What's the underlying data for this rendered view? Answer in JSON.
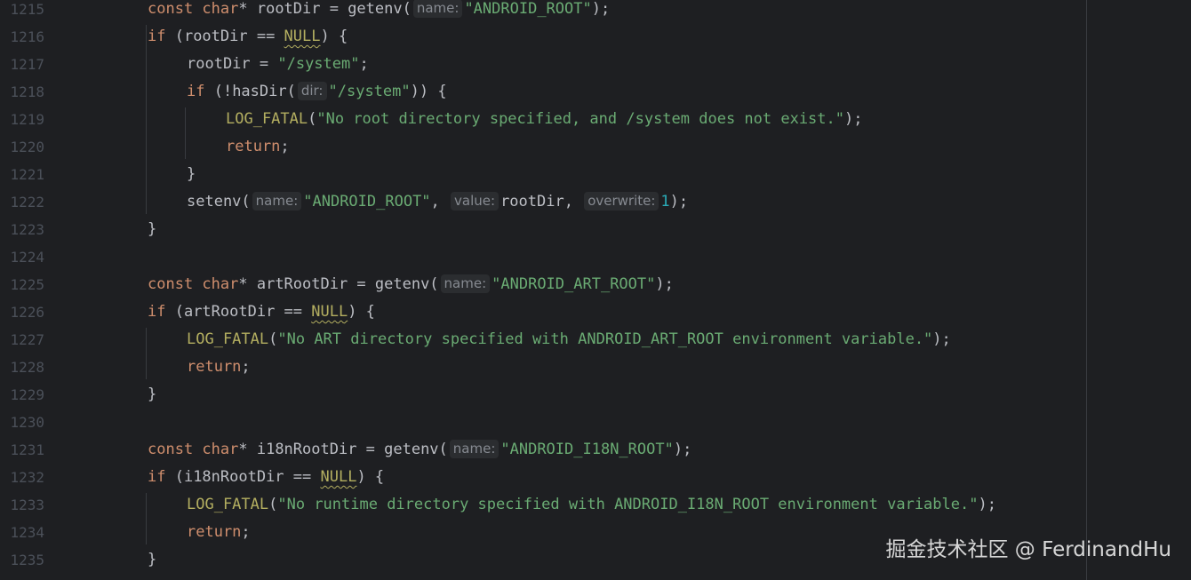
{
  "lines": [
    {
      "num": "1215",
      "indent": 1,
      "tokens": [
        {
          "t": "kw",
          "v": "const "
        },
        {
          "t": "kw",
          "v": "char"
        },
        {
          "t": "p",
          "v": "* rootDir = getenv("
        },
        {
          "t": "hint",
          "v": "name:"
        },
        {
          "t": "str",
          "v": "\"ANDROID_ROOT\""
        },
        {
          "t": "p",
          "v": ");"
        }
      ]
    },
    {
      "num": "1216",
      "indent": 1,
      "tokens": [
        {
          "t": "kw",
          "v": "if "
        },
        {
          "t": "p",
          "v": "(rootDir == "
        },
        {
          "t": "null",
          "v": "NULL"
        },
        {
          "t": "p",
          "v": ") {"
        }
      ]
    },
    {
      "num": "1217",
      "indent": 2,
      "tokens": [
        {
          "t": "p",
          "v": "rootDir = "
        },
        {
          "t": "str",
          "v": "\"/system\""
        },
        {
          "t": "p",
          "v": ";"
        }
      ]
    },
    {
      "num": "1218",
      "indent": 2,
      "tokens": [
        {
          "t": "kw",
          "v": "if "
        },
        {
          "t": "p",
          "v": "(!hasDir("
        },
        {
          "t": "hint",
          "v": "dir:"
        },
        {
          "t": "str",
          "v": "\"/system\""
        },
        {
          "t": "p",
          "v": ")) {"
        }
      ]
    },
    {
      "num": "1219",
      "indent": 3,
      "tokens": [
        {
          "t": "macro",
          "v": "LOG_FATAL"
        },
        {
          "t": "p",
          "v": "("
        },
        {
          "t": "str",
          "v": "\"No root directory specified, and /system does not exist.\""
        },
        {
          "t": "p",
          "v": ");"
        }
      ]
    },
    {
      "num": "1220",
      "indent": 3,
      "tokens": [
        {
          "t": "kw",
          "v": "return"
        },
        {
          "t": "p",
          "v": ";"
        }
      ]
    },
    {
      "num": "1221",
      "indent": 2,
      "tokens": [
        {
          "t": "p",
          "v": "}"
        }
      ]
    },
    {
      "num": "1222",
      "indent": 2,
      "tokens": [
        {
          "t": "p",
          "v": "setenv("
        },
        {
          "t": "hint",
          "v": "name:"
        },
        {
          "t": "str",
          "v": "\"ANDROID_ROOT\""
        },
        {
          "t": "p",
          "v": ", "
        },
        {
          "t": "hint",
          "v": "value:"
        },
        {
          "t": "p",
          "v": "rootDir, "
        },
        {
          "t": "hint",
          "v": "overwrite:"
        },
        {
          "t": "num",
          "v": "1"
        },
        {
          "t": "p",
          "v": ");"
        }
      ]
    },
    {
      "num": "1223",
      "indent": 1,
      "tokens": [
        {
          "t": "p",
          "v": "}"
        }
      ]
    },
    {
      "num": "1224",
      "indent": 1,
      "tokens": []
    },
    {
      "num": "1225",
      "indent": 1,
      "tokens": [
        {
          "t": "kw",
          "v": "const "
        },
        {
          "t": "kw",
          "v": "char"
        },
        {
          "t": "p",
          "v": "* artRootDir = getenv("
        },
        {
          "t": "hint",
          "v": "name:"
        },
        {
          "t": "str",
          "v": "\"ANDROID_ART_ROOT\""
        },
        {
          "t": "p",
          "v": ");"
        }
      ]
    },
    {
      "num": "1226",
      "indent": 1,
      "tokens": [
        {
          "t": "kw",
          "v": "if "
        },
        {
          "t": "p",
          "v": "(artRootDir == "
        },
        {
          "t": "null",
          "v": "NULL"
        },
        {
          "t": "p",
          "v": ") {"
        }
      ]
    },
    {
      "num": "1227",
      "indent": 2,
      "tokens": [
        {
          "t": "macro",
          "v": "LOG_FATAL"
        },
        {
          "t": "p",
          "v": "("
        },
        {
          "t": "str",
          "v": "\"No ART directory specified with ANDROID_ART_ROOT environment variable.\""
        },
        {
          "t": "p",
          "v": ");"
        }
      ]
    },
    {
      "num": "1228",
      "indent": 2,
      "tokens": [
        {
          "t": "kw",
          "v": "return"
        },
        {
          "t": "p",
          "v": ";"
        }
      ]
    },
    {
      "num": "1229",
      "indent": 1,
      "tokens": [
        {
          "t": "p",
          "v": "}"
        }
      ]
    },
    {
      "num": "1230",
      "indent": 1,
      "tokens": []
    },
    {
      "num": "1231",
      "indent": 1,
      "tokens": [
        {
          "t": "kw",
          "v": "const "
        },
        {
          "t": "kw",
          "v": "char"
        },
        {
          "t": "p",
          "v": "* i18nRootDir = getenv("
        },
        {
          "t": "hint",
          "v": "name:"
        },
        {
          "t": "str",
          "v": "\"ANDROID_I18N_ROOT\""
        },
        {
          "t": "p",
          "v": ");"
        }
      ]
    },
    {
      "num": "1232",
      "indent": 1,
      "tokens": [
        {
          "t": "kw",
          "v": "if "
        },
        {
          "t": "p",
          "v": "(i18nRootDir == "
        },
        {
          "t": "null",
          "v": "NULL"
        },
        {
          "t": "p",
          "v": ") {"
        }
      ]
    },
    {
      "num": "1233",
      "indent": 2,
      "tokens": [
        {
          "t": "macro",
          "v": "LOG_FATAL"
        },
        {
          "t": "p",
          "v": "("
        },
        {
          "t": "str",
          "v": "\"No runtime directory specified with ANDROID_I18N_ROOT environment variable.\""
        },
        {
          "t": "p",
          "v": ");"
        }
      ]
    },
    {
      "num": "1234",
      "indent": 2,
      "tokens": [
        {
          "t": "kw",
          "v": "return"
        },
        {
          "t": "p",
          "v": ";"
        }
      ]
    },
    {
      "num": "1235",
      "indent": 1,
      "tokens": [
        {
          "t": "p",
          "v": "}"
        }
      ]
    }
  ],
  "watermark": "掘金技术社区 @ FerdinandHu",
  "colors": {
    "background": "#1e1f22",
    "keyword": "#cf8e6d",
    "string": "#6aab73",
    "number": "#2aacb8",
    "macro": "#b3ae60",
    "text": "#bcbec4",
    "line_number": "#4b5059",
    "hint_bg": "#2b2d30",
    "hint_text": "#868a91"
  }
}
